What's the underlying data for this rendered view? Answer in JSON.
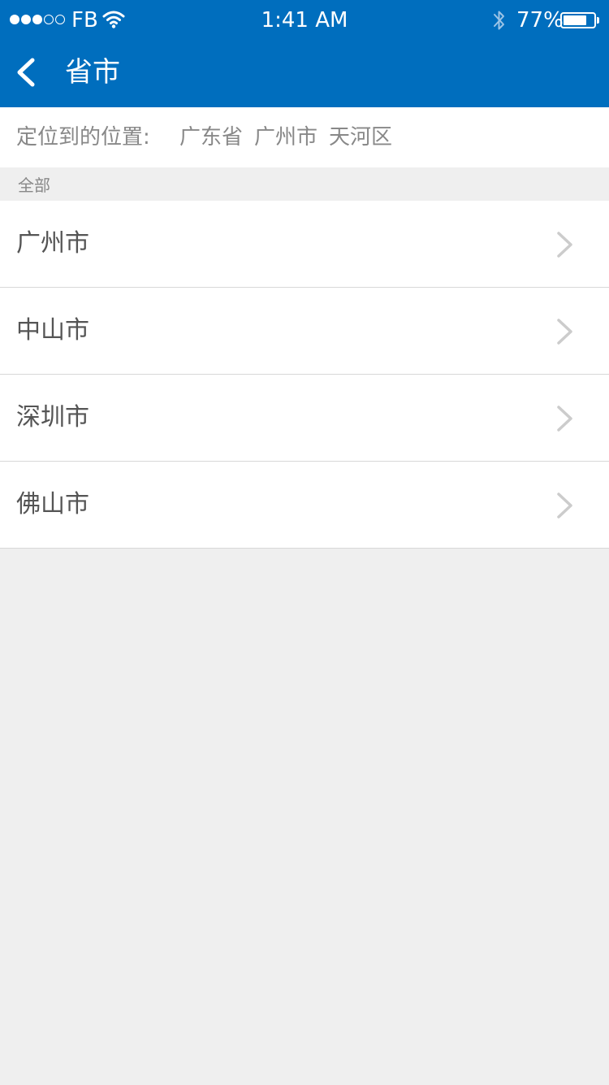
{
  "status_bar": {
    "carrier": "FB",
    "time": "1:41 AM",
    "battery_percent_text": "77%",
    "battery_level": 0.77,
    "signal_bars_filled": 3,
    "signal_bars_total": 5
  },
  "nav": {
    "title": "省市",
    "back_icon": "chevron-left-icon"
  },
  "location": {
    "label": "定位到的位置:",
    "province": "广东省",
    "city": "广州市",
    "district": "天河区"
  },
  "section": {
    "title": "全部"
  },
  "list": {
    "items": [
      {
        "label": "广州市"
      },
      {
        "label": "中山市"
      },
      {
        "label": "深圳市"
      },
      {
        "label": "佛山市"
      }
    ]
  },
  "colors": {
    "brand_blue": "#006ebe",
    "background": "#efefef",
    "text_primary": "#555555",
    "text_secondary": "#888888",
    "divider": "#d8d8d8"
  }
}
